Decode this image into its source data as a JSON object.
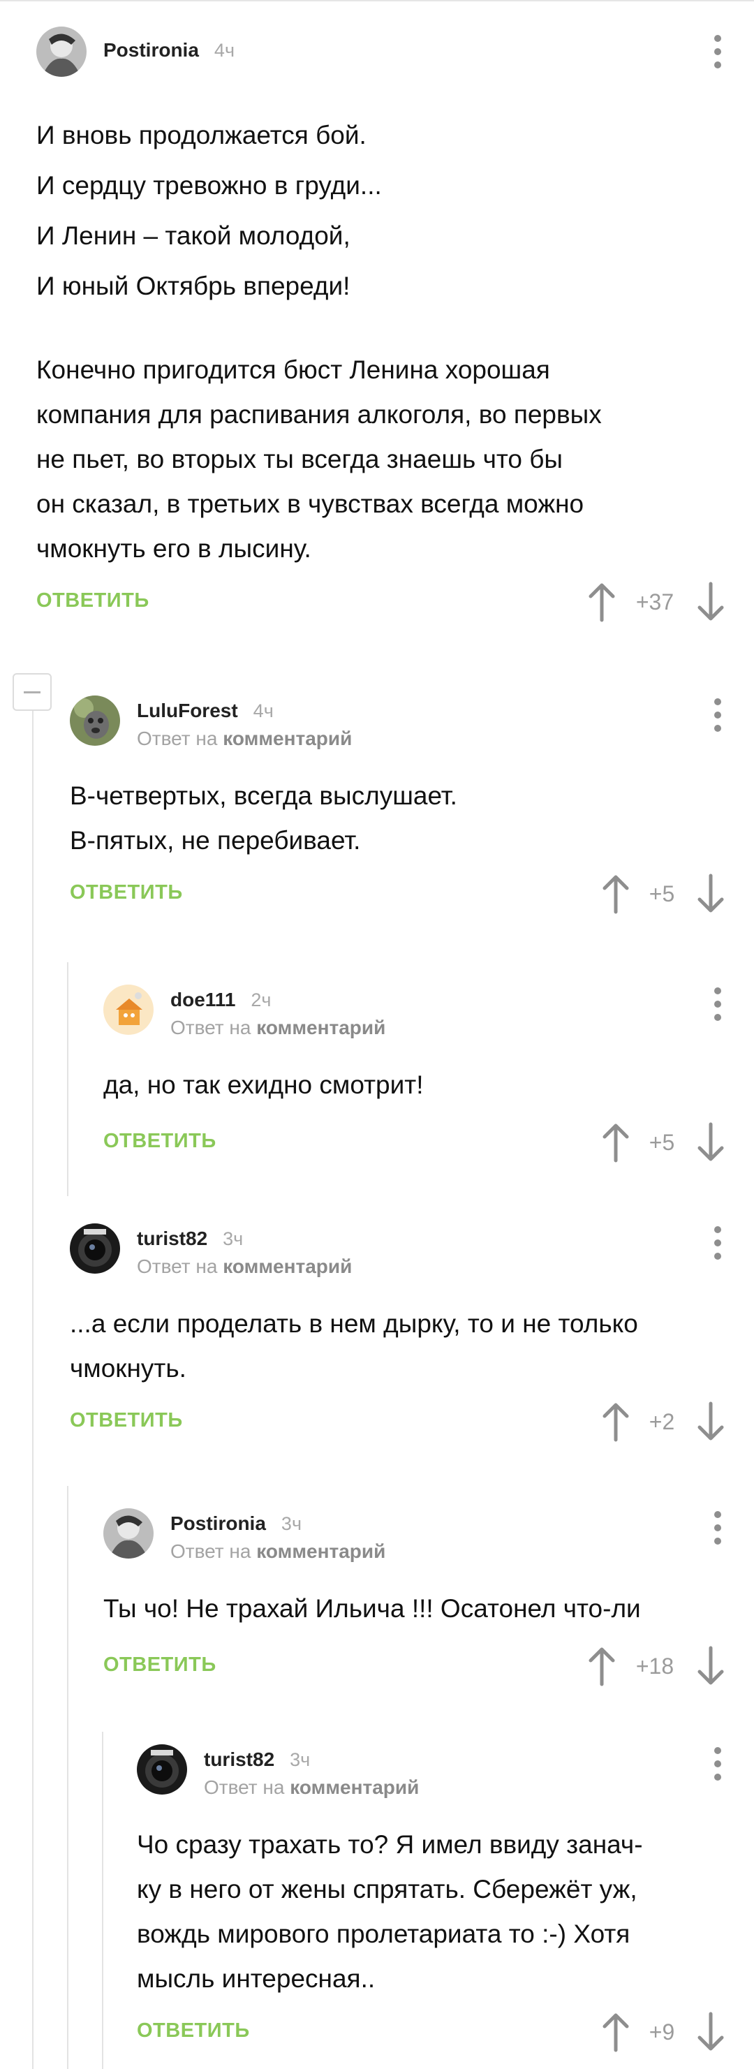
{
  "labels": {
    "reply": "ОТВЕТИТЬ",
    "reply_to_prefix": "Ответ на",
    "reply_to_link": "комментарий"
  },
  "comments": [
    {
      "author": "Postironia",
      "time": "4ч",
      "avatar": "bw-portrait-avatar",
      "lines": [
        "И вновь продолжается бой.",
        "И сердцу тревожно в груди...",
        "И Ленин – такой молодой,",
        "И юный Октябрь впереди!",
        "",
        "Конечно пригодится бюст Ленина хорошая",
        "компания для распивания алкоголя, во первых",
        "не пьет, во вторых ты всегда знаешь что бы",
        "он сказал, в третьих в чувствах всегда можно",
        "чмокнуть его в лысину."
      ],
      "score": "+37"
    },
    {
      "author": "LuluForest",
      "time": "4ч",
      "avatar": "dog-photo-avatar",
      "lines": [
        "В-четвертых, всегда выслушает.",
        "В-пятых, не перебивает."
      ],
      "score": "+5"
    },
    {
      "author": "doe111",
      "time": "2ч",
      "avatar": "cartoon-house-avatar",
      "lines": [
        "да, но так ехидно смотрит!"
      ],
      "score": "+5"
    },
    {
      "author": "turist82",
      "time": "3ч",
      "avatar": "camera-lens-avatar",
      "lines": [
        "...а если проделать в нем дырку, то и не только",
        "чмокнуть."
      ],
      "score": "+2"
    },
    {
      "author": "Postironia",
      "time": "3ч",
      "avatar": "bw-portrait-avatar",
      "lines": [
        "Ты чо! Не трахай Ильича !!! Осатонел что-ли"
      ],
      "score": "+18"
    },
    {
      "author": "turist82",
      "time": "3ч",
      "avatar": "camera-lens-avatar",
      "lines": [
        "Чо сразу трахать то? Я имел ввиду занач-",
        "ку в него от жены спрятать. Сбережёт уж,",
        "вождь мирового пролетариата то :-) Хотя",
        "мысль интересная.."
      ],
      "score": "+9"
    }
  ],
  "colors": {
    "reply": "#8ac858",
    "meta": "#a3a3a3",
    "thread_line": "#e3e3e3"
  }
}
